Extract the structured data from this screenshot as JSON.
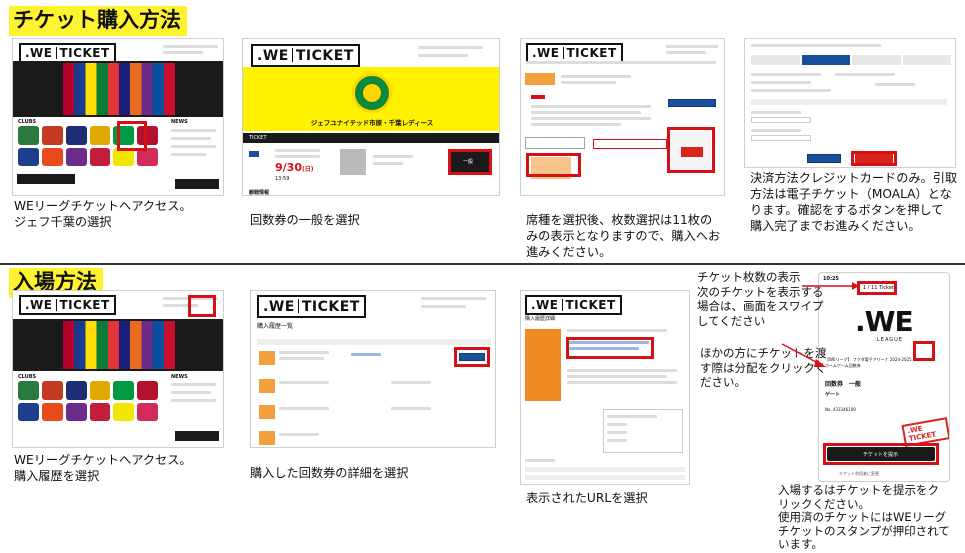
{
  "sections": {
    "purchase_title": "チケット購入方法",
    "entry_title": "入場方法"
  },
  "captions": {
    "p1": "WEリーグチケットへアクセス。\nジェフ千葉の選択",
    "p2": "回数券の一般を選択",
    "p3": "席種を選択後、枚数選択は11枚の\nみの表示となりますので、購入へお\n進みください。",
    "p4": "決済方法クレジットカードのみ。引取\n方法は電子チケット（MOALA）とな\nります。確認をするボタンを押して\n購入完了までお進みください。",
    "e1": "WEリーグチケットへアクセス。\n購入履歴を選択",
    "e2": "購入した回数券の詳細を選択",
    "e3": "表示されたURLを選択",
    "e4_top": "チケット枚数の表示\n次のチケットを表示する\n場合は、画面をスワイプ\nしてください",
    "e4_mid": "ほかの方にチケットを渡\nす際は分配をクリックく\nださい。",
    "e4_bottom": "入場するはチケットを提示をク\nリックください。\n使用済のチケットにはWEリーグ\nチケットのスタンプが押印されて\nいます。"
  },
  "brand": {
    "logo_we": ".WE",
    "logo_ticket": "TICKET",
    "league_logo": ".WE",
    "league_word": "LEAGUE",
    "stamp": ".WE TICKET"
  },
  "shots": {
    "s1_clubs": "CLUBS",
    "s1_news": "NEWS",
    "s2_club_name": "ジェフユナイテッド市原・千葉レディース",
    "s2_ticket_label": "TICKET",
    "s2_date": "9/30",
    "s2_weekday": "(日)",
    "s2_time": "13:59",
    "s2_seat_label": "一般",
    "s2_sold": "販売期間",
    "s2_info": "観戦情報",
    "s6_title": "購入履歴一覧",
    "s7_title": "購入履歴詳細",
    "phone_time": "10:25",
    "phone_count": "1 / 11 Tickets",
    "phone_event": "【WEリーグ】 フクダ電子アリーナ 2024-2025 ホームゲーム回数券",
    "phone_kind": "回数券　一般",
    "phone_gate": "ゲート",
    "phone_no": "No. 433346109",
    "phone_button": "チケットを提示",
    "phone_footer": "チケット利用者に変更"
  },
  "colors": {
    "highlight": "#d90f16",
    "title_bg": "#fef331",
    "jef_yellow": "#fff200",
    "order_orange": "#f2a03d",
    "blue_button": "#1b4f9c"
  }
}
